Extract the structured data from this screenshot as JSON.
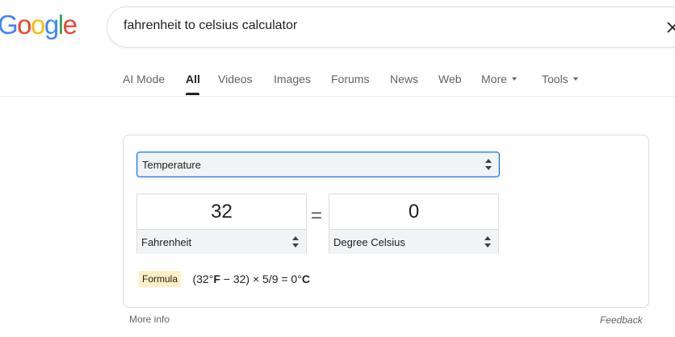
{
  "logo": {
    "letters": [
      {
        "char": "G",
        "color": "#4285f4"
      },
      {
        "char": "o",
        "color": "#ea4335"
      },
      {
        "char": "o",
        "color": "#fbbc05"
      },
      {
        "char": "g",
        "color": "#4285f4"
      },
      {
        "char": "l",
        "color": "#34a853"
      },
      {
        "char": "e",
        "color": "#ea4335"
      }
    ]
  },
  "search": {
    "query": "fahrenheit to celsius calculator",
    "clear_icon": "close-icon"
  },
  "tabs": {
    "ai_mode": "AI Mode",
    "all": "All",
    "videos": "Videos",
    "images": "Images",
    "forums": "Forums",
    "news": "News",
    "web": "Web",
    "more": "More",
    "tools": "Tools"
  },
  "converter": {
    "category": "Temperature",
    "left_value": "32",
    "left_unit": "Fahrenheit",
    "equals": "=",
    "right_value": "0",
    "right_unit": "Degree Celsius",
    "formula_label": "Formula",
    "formula": {
      "part1": "(32°",
      "unit1": "F",
      "part2": " − 32) × 5/9 = 0°",
      "unit2": "C"
    }
  },
  "footer": {
    "more_info": "More info",
    "feedback": "Feedback"
  },
  "colors": {
    "accent_blue": "#1a73e8",
    "formula_badge_bg": "#feefc3"
  }
}
